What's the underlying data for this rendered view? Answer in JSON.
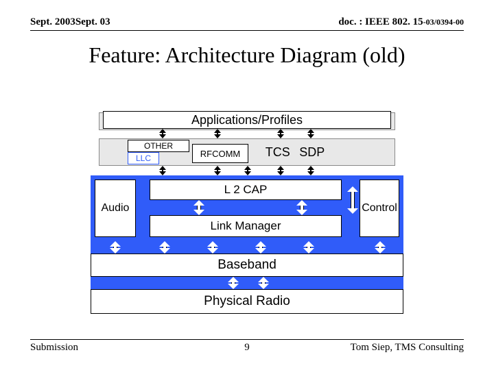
{
  "header": {
    "left": "Sept. 2003Sept. 03",
    "right_prefix": "doc. : IEEE 802. 15",
    "right_suffix": "-03/0394-00"
  },
  "title": "Feature: Architecture Diagram (old)",
  "footer": {
    "left": "Submission",
    "center": "9",
    "right": "Tom Siep, TMS Consulting"
  },
  "diagram": {
    "top_band": "Applications/Profiles",
    "other": "OTHER",
    "llc": "LLC",
    "rfcomm": "RFCOMM",
    "tcs": "TCS",
    "sdp": "SDP",
    "audio": "Audio",
    "l2cap": "L 2 CAP",
    "control": "Control",
    "link_manager": "Link Manager",
    "baseband": "Baseband",
    "physical_radio": "Physical Radio"
  },
  "colors": {
    "blue": "#305cf9"
  }
}
